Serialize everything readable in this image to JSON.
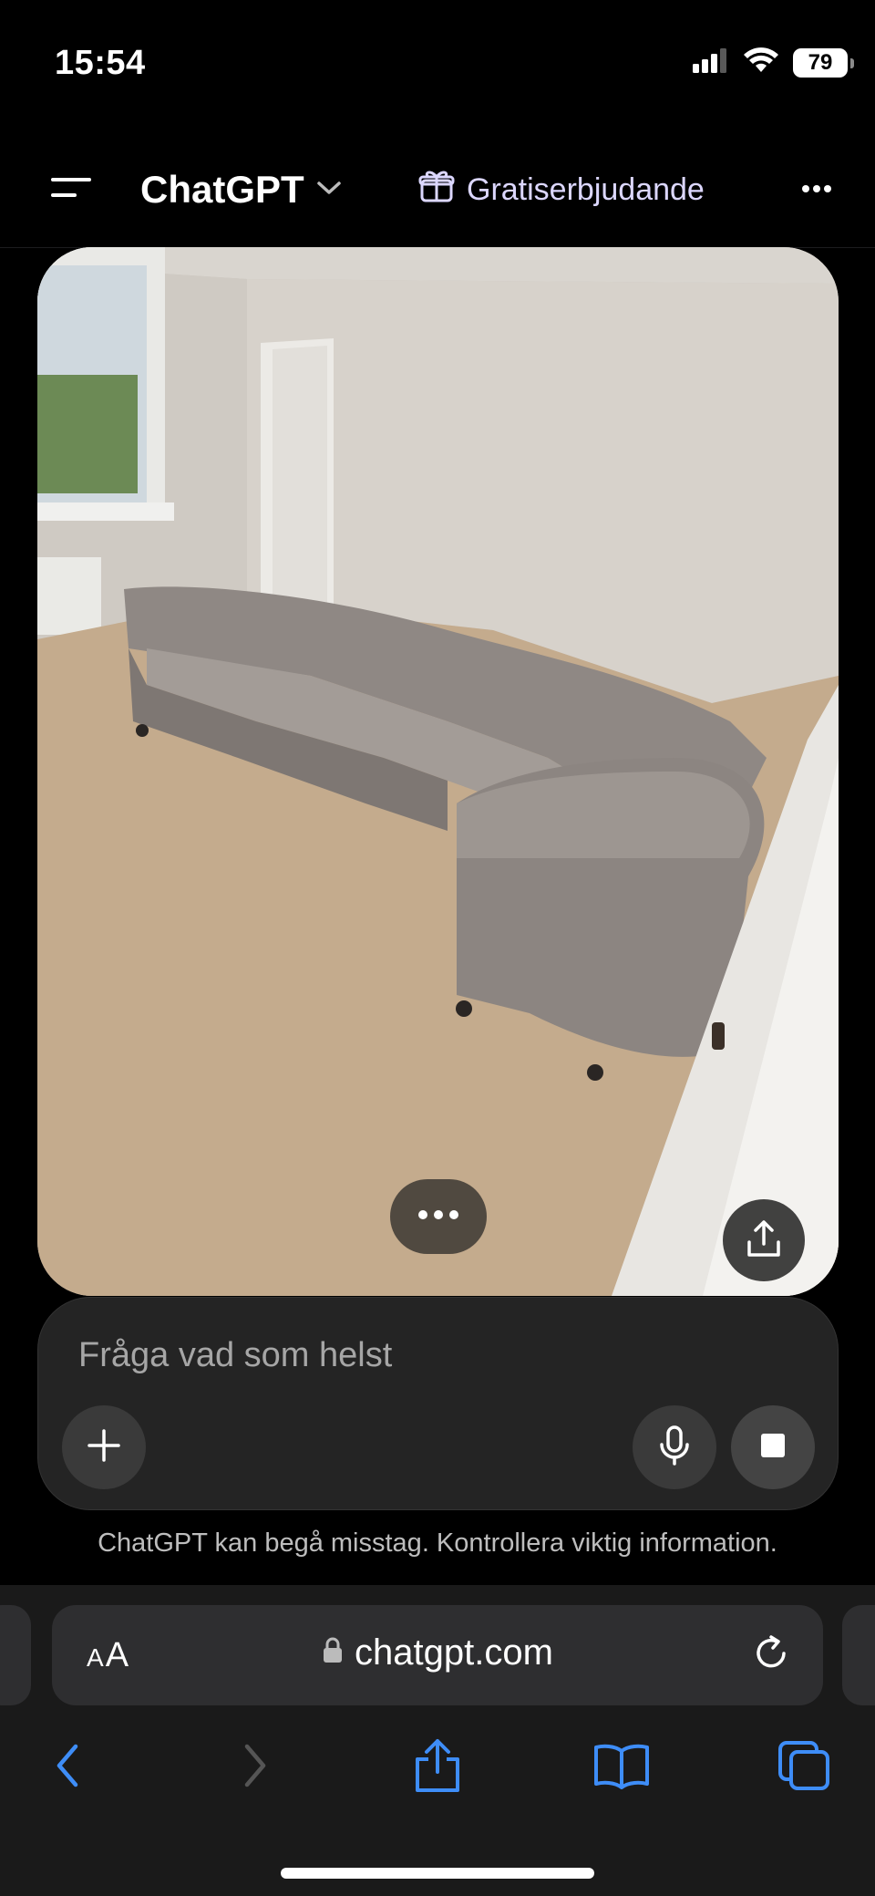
{
  "status_bar": {
    "time": "15:54",
    "battery": "79",
    "icons": [
      "signal-icon",
      "wifi-icon",
      "battery-icon"
    ]
  },
  "header": {
    "title": "ChatGPT",
    "promo_label": "Gratiserbjudande",
    "icons": [
      "menu-icon",
      "chevron-down-icon",
      "gift-icon",
      "more-icon"
    ]
  },
  "image": {
    "description_label": "Uploaded photo",
    "controls": [
      "more-options-icon",
      "share-icon"
    ]
  },
  "composer": {
    "placeholder": "Fråga vad som helst",
    "buttons": [
      "plus-icon",
      "microphone-icon",
      "stop-icon"
    ]
  },
  "disclaimer": "ChatGPT kan begå misstag. Kontrollera viktig information.",
  "safari": {
    "text_size_label_small": "A",
    "text_size_label_large": "A",
    "url": "chatgpt.com",
    "nav_icons": [
      "back-icon",
      "forward-icon",
      "share-icon",
      "bookmarks-icon",
      "tabs-icon"
    ]
  },
  "colors": {
    "background": "#000000",
    "accent_blue": "#3e8df7",
    "promo_text": "#dcd7ff",
    "composer_bg": "#242424"
  }
}
